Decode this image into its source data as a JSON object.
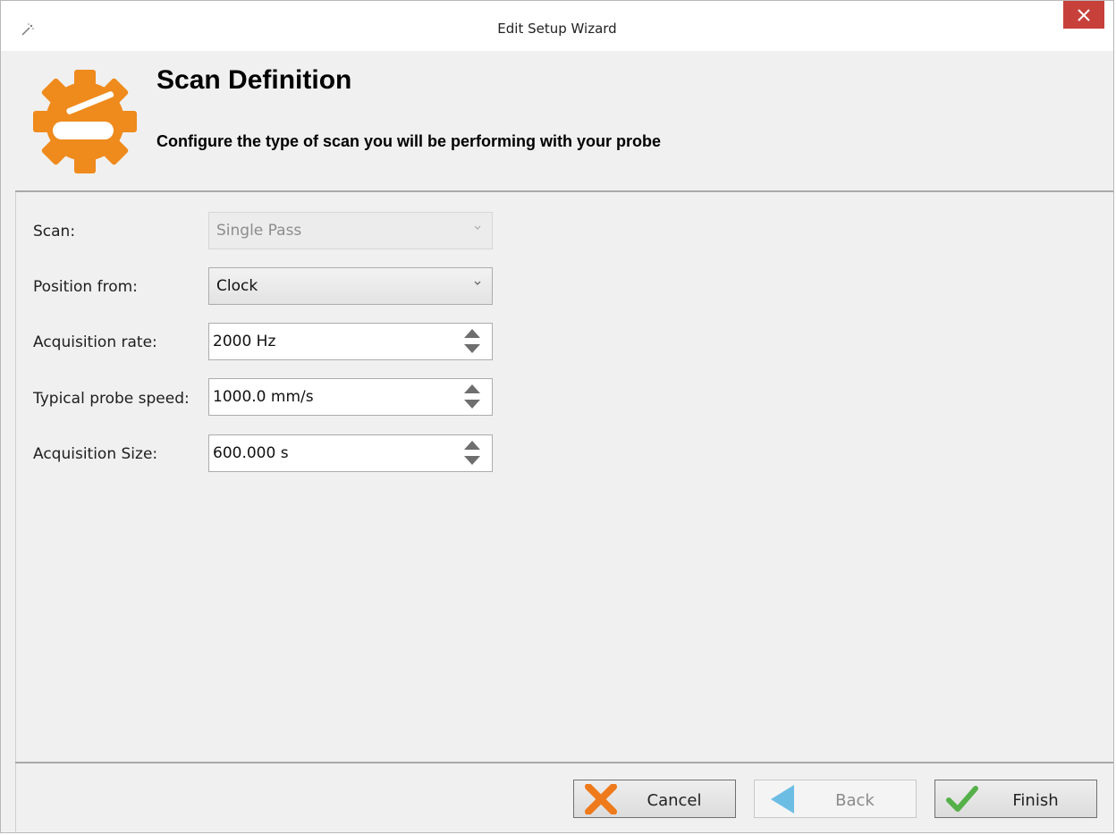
{
  "window": {
    "title": "Edit Setup Wizard",
    "close_color": "#c7403a"
  },
  "header": {
    "title": "Scan Definition",
    "subtitle": "Configure the type of scan you will be performing with your probe",
    "icon": "gear-scanner-icon",
    "accent_color": "#ef8a1c"
  },
  "form": {
    "scan": {
      "label": "Scan:",
      "value": "Single Pass",
      "disabled": true
    },
    "position_from": {
      "label": "Position from:",
      "value": "Clock"
    },
    "acquisition_rate": {
      "label": "Acquisition rate:",
      "value": "2000 Hz"
    },
    "probe_speed": {
      "label": "Typical probe speed:",
      "value": "1000.0 mm/s"
    },
    "acquisition_size": {
      "label": "Acquisition Size:",
      "value": "600.000 s"
    }
  },
  "footer": {
    "cancel_label": "Cancel",
    "back_label": "Back",
    "finish_label": "Finish",
    "cancel_icon": "x-icon",
    "back_icon": "back-arrow-icon",
    "finish_icon": "checkmark-icon"
  }
}
